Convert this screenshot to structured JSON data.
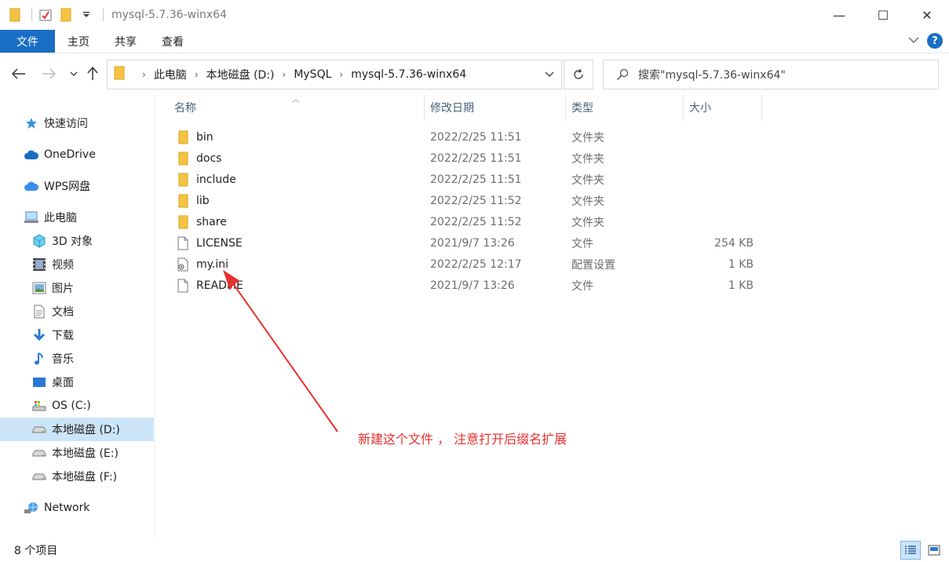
{
  "window": {
    "title": "mysql-5.7.36-winx64",
    "minimize": "—",
    "maximize": "☐",
    "close": "✕"
  },
  "ribbon": {
    "tabs": [
      "文件",
      "主页",
      "共享",
      "查看"
    ],
    "help": "?"
  },
  "address": {
    "crumbs": [
      "此电脑",
      "本地磁盘 (D:)",
      "MySQL",
      "mysql-5.7.36-winx64"
    ]
  },
  "search": {
    "placeholder": "搜索\"mysql-5.7.36-winx64\""
  },
  "sidebar": {
    "items": [
      {
        "label": "快速访问",
        "icon": "star-icon"
      },
      {
        "label": "OneDrive",
        "icon": "cloud-icon"
      },
      {
        "label": "WPS网盘",
        "icon": "cloud-icon"
      },
      {
        "label": "此电脑",
        "icon": "computer-icon"
      },
      {
        "label": "3D 对象",
        "icon": "cube-icon"
      },
      {
        "label": "视频",
        "icon": "video-icon"
      },
      {
        "label": "图片",
        "icon": "picture-icon"
      },
      {
        "label": "文档",
        "icon": "document-icon"
      },
      {
        "label": "下载",
        "icon": "download-icon"
      },
      {
        "label": "音乐",
        "icon": "music-icon"
      },
      {
        "label": "桌面",
        "icon": "desktop-icon"
      },
      {
        "label": "OS (C:)",
        "icon": "drive-icon"
      },
      {
        "label": "本地磁盘 (D:)",
        "icon": "drive-icon"
      },
      {
        "label": "本地磁盘 (E:)",
        "icon": "drive-icon"
      },
      {
        "label": "本地磁盘 (F:)",
        "icon": "drive-icon"
      },
      {
        "label": "Network",
        "icon": "network-icon"
      }
    ]
  },
  "columns": {
    "name": "名称",
    "date": "修改日期",
    "type": "类型",
    "size": "大小"
  },
  "files": [
    {
      "name": "bin",
      "date": "2022/2/25 11:51",
      "type": "文件夹",
      "size": "",
      "icon": "folder-icon"
    },
    {
      "name": "docs",
      "date": "2022/2/25 11:51",
      "type": "文件夹",
      "size": "",
      "icon": "folder-icon"
    },
    {
      "name": "include",
      "date": "2022/2/25 11:51",
      "type": "文件夹",
      "size": "",
      "icon": "folder-icon"
    },
    {
      "name": "lib",
      "date": "2022/2/25 11:52",
      "type": "文件夹",
      "size": "",
      "icon": "folder-icon"
    },
    {
      "name": "share",
      "date": "2022/2/25 11:52",
      "type": "文件夹",
      "size": "",
      "icon": "folder-icon"
    },
    {
      "name": "LICENSE",
      "date": "2021/9/7 13:26",
      "type": "文件",
      "size": "254 KB",
      "icon": "file-icon"
    },
    {
      "name": "my.ini",
      "date": "2022/2/25 12:17",
      "type": "配置设置",
      "size": "1 KB",
      "icon": "settings-file-icon"
    },
    {
      "name": "README",
      "date": "2021/9/7 13:26",
      "type": "文件",
      "size": "1 KB",
      "icon": "file-icon"
    }
  ],
  "status": {
    "count": "8 个项目"
  },
  "annotation": {
    "text": "新建这个文件 ， 注意打开后缀名扩展",
    "color": "#e8312e"
  },
  "colors": {
    "accent": "#1a6ec4",
    "selection": "#cce4f7",
    "folder": "#f5c342"
  }
}
